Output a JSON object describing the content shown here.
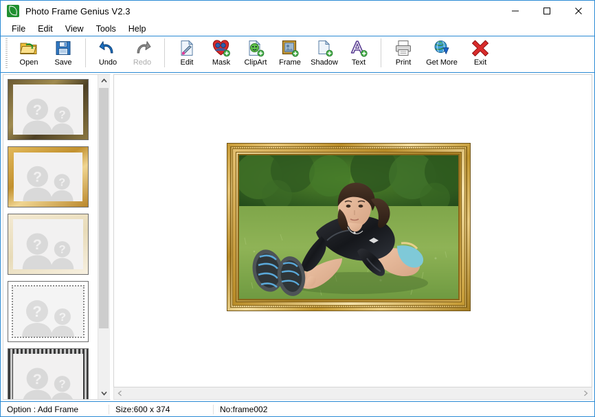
{
  "window": {
    "title": "Photo Frame Genius V2.3",
    "app_icon": "leaf-icon",
    "controls": {
      "minimize": "minimize-icon",
      "maximize": "maximize-icon",
      "close": "close-icon"
    },
    "accent_color": "#2a8ad4"
  },
  "menubar": {
    "items": [
      {
        "label": "File"
      },
      {
        "label": "Edit"
      },
      {
        "label": "View"
      },
      {
        "label": "Tools"
      },
      {
        "label": "Help"
      }
    ]
  },
  "toolbar": {
    "buttons": [
      {
        "label": "Open",
        "icon": "open-folder-icon",
        "enabled": true
      },
      {
        "label": "Save",
        "icon": "floppy-disk-icon",
        "enabled": true
      },
      {
        "label": "Undo",
        "icon": "undo-arrow-icon",
        "enabled": true
      },
      {
        "label": "Redo",
        "icon": "redo-arrow-icon",
        "enabled": false
      },
      {
        "label": "Edit",
        "icon": "edit-pen-icon",
        "enabled": true
      },
      {
        "label": "Mask",
        "icon": "heart-mask-icon",
        "enabled": true
      },
      {
        "label": "ClipArt",
        "icon": "clipart-smiley-icon",
        "enabled": true
      },
      {
        "label": "Frame",
        "icon": "picture-frame-icon",
        "enabled": true
      },
      {
        "label": "Shadow",
        "icon": "shadow-page-icon",
        "enabled": true
      },
      {
        "label": "Text",
        "icon": "text-a-icon",
        "enabled": true
      },
      {
        "label": "Print",
        "icon": "printer-icon",
        "enabled": true
      },
      {
        "label": "Get More",
        "icon": "globe-download-icon",
        "enabled": true
      },
      {
        "label": "Exit",
        "icon": "red-x-icon",
        "enabled": true
      }
    ]
  },
  "sidebar": {
    "scroll": {
      "up_arrow": "chevron-up-icon",
      "down_arrow": "chevron-down-icon",
      "thumb_position_percent": 0,
      "thumb_size_percent": 80
    },
    "thumbnails": [
      {
        "name": "frame-thumbnail-1",
        "style": "ornate-dark-gold",
        "placeholder": "two-person-question-placeholder"
      },
      {
        "name": "frame-thumbnail-2",
        "style": "bright-gold-bevel",
        "placeholder": "two-person-question-placeholder"
      },
      {
        "name": "frame-thumbnail-3",
        "style": "cream-corner-ornament",
        "placeholder": "two-person-question-placeholder"
      },
      {
        "name": "frame-thumbnail-4",
        "style": "white-dotted-border",
        "placeholder": "two-person-question-placeholder"
      },
      {
        "name": "frame-thumbnail-5",
        "style": "black-white-striped",
        "placeholder": "two-person-question-placeholder"
      }
    ]
  },
  "canvas": {
    "photo": {
      "frame_style": "ornate-gold-frame",
      "subject": "woman-stretching-on-grass",
      "description": "Young woman in black long-sleeve athletic top and light shorts stretching forward toward her running shoes on a green lawn with blurred shrubs behind"
    },
    "hscroll": {
      "left_arrow": "chevron-left-icon",
      "right_arrow": "chevron-right-icon"
    }
  },
  "statusbar": {
    "option": "Option : Add Frame",
    "size": "Size:600 x 374",
    "number": "No:frame002"
  }
}
